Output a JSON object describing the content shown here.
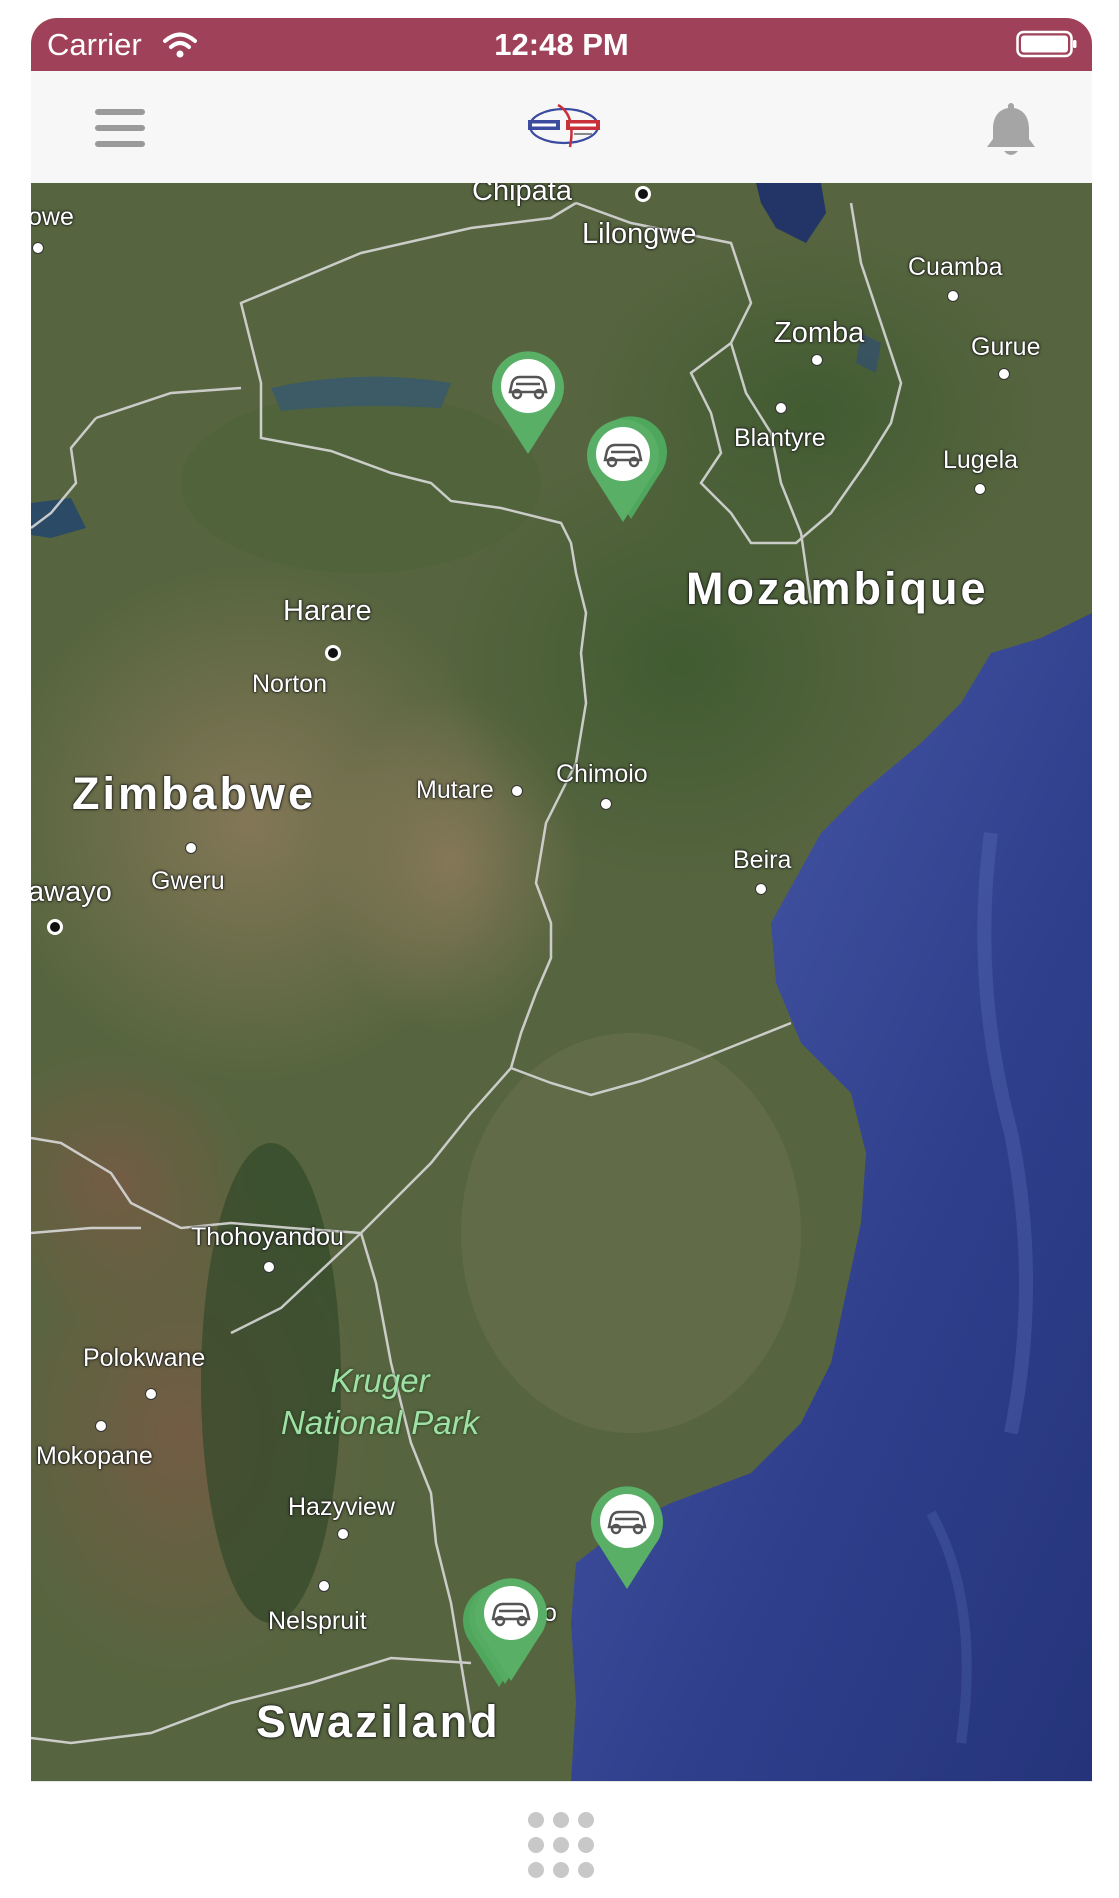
{
  "status_bar": {
    "carrier": "Carrier",
    "time": "12:48 PM",
    "background": "#9f4259"
  },
  "nav_bar": {
    "menu_icon": "hamburger-menu-icon",
    "logo_icon": "fleet-track-logo",
    "notification_icon": "bell-icon"
  },
  "map": {
    "type": "satellite",
    "countries": [
      "Zimbabwe",
      "Mozambique",
      "Swaziland"
    ],
    "cities": [
      "Chipata",
      "Lilongwe",
      "Cuamba",
      "Zomba",
      "Gurue",
      "Blantyre",
      "Lugela",
      "Harare",
      "Norton",
      "Mutare",
      "Chimoio",
      "Gweru",
      "awayo",
      "Beira",
      "Thohoyandou",
      "Polokwane",
      "Mokopane",
      "Hazyview",
      "Nelspruit",
      "owe",
      "o"
    ],
    "parks": [
      "Kruger",
      "National Park"
    ],
    "markers": [
      {
        "icon": "car-icon",
        "color": "#5aaf66"
      },
      {
        "icon": "car-icon",
        "color": "#5aaf66",
        "stacked": true
      },
      {
        "icon": "car-icon",
        "color": "#5aaf66"
      },
      {
        "icon": "car-icon",
        "color": "#5aaf66",
        "stacked": true
      }
    ]
  },
  "bottom_bar": {
    "apps_icon": "grid-dots-icon"
  }
}
